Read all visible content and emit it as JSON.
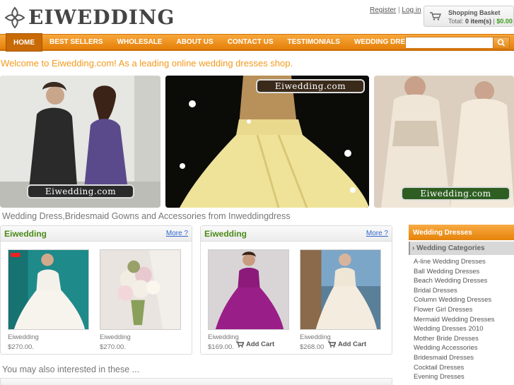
{
  "header": {
    "logo_text": "Eiwedding",
    "register": "Register",
    "separator": " | ",
    "login": "Log in",
    "basket_title": "Shopping Basket",
    "basket_total_label": "Total:",
    "basket_items": "0 item(s)",
    "basket_sep": " | ",
    "basket_price": "$0.00"
  },
  "nav": {
    "items": [
      "HOME",
      "BEST SELLERS",
      "WHOLESALE",
      "ABOUT US",
      "CONTACT US",
      "TESTIMONIALS",
      "WEDDING DRESSES"
    ],
    "search_placeholder": ""
  },
  "welcome": "Welcome to Eiwedding.com! As a leading online wedding dresses shop.",
  "banners": [
    {
      "stamp": "Eiwedding.com"
    },
    {
      "stamp": "Eiwedding.com"
    },
    {
      "stamp": "Eiwedding.com"
    }
  ],
  "subtitle": "Wedding Dress,Bridesmaid Gowns and Accessories from Inweddingdress",
  "boxes": [
    {
      "title": "Eiwedding",
      "more": "More ?",
      "products": [
        {
          "name": "Eiwedding",
          "price": "$270.00."
        },
        {
          "name": "Eiwedding",
          "price": "$270.00."
        }
      ]
    },
    {
      "title": "Eiwedding",
      "more": "More ?",
      "products": [
        {
          "name": "Eiwedding",
          "price": "$169.00.",
          "cart": "Add Cart"
        },
        {
          "name": "Eiwedding",
          "price": "$268.00",
          "cart": "Add Cart"
        }
      ]
    }
  ],
  "interested": "You may also interested in these ...",
  "sidebar": {
    "header": "Wedding Dresses",
    "category": "Wedding Categories",
    "items": [
      "A-line Wedding Dresses",
      "Ball Wedding Dresses",
      "Beach Wedding Dresses",
      "Bridal Dresses",
      "Column Wedding Dresses",
      "Flower Girl Dresses",
      "Mermaid Wedding Dresses",
      "Wedding Dresses 2010",
      "Mother Bride Dresses",
      "Wedding Accessories",
      "Bridesmaid Dresses",
      "Cocktail Dresses",
      "Evening Dresses"
    ]
  },
  "colors": {
    "accent": "#f29a1c",
    "nav": "#e57f08",
    "box_title": "#4a8a18",
    "price_green": "#3a9a1a"
  }
}
